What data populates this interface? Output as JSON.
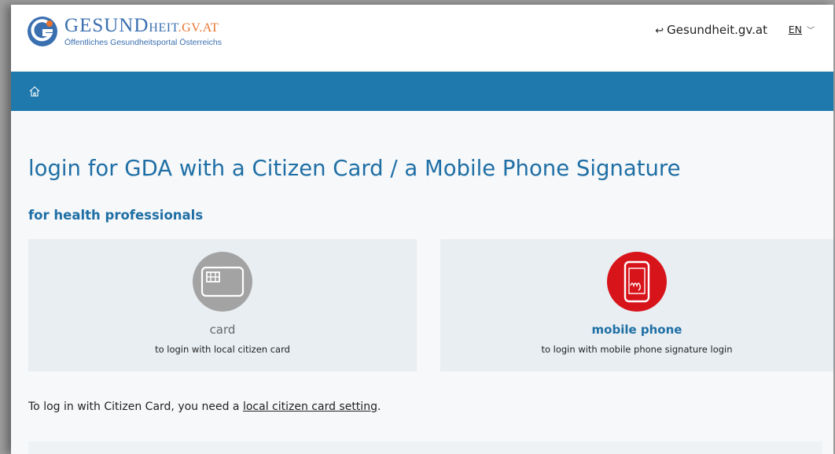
{
  "header": {
    "brand_big": "G",
    "brand_word": "ESUND",
    "brand_rest": "HEIT",
    "brand_domain": ".GV.AT",
    "tagline": "Öffentliches Gesundheitsportal Österreichs",
    "portal_link": "Gesundheit.gv.at",
    "language": "EN"
  },
  "main": {
    "title": "login for GDA with a Citizen Card / a Mobile Phone Signature",
    "subtitle": "for health professionals",
    "options": [
      {
        "label": "card",
        "description": "to login with local citizen card",
        "icon": "citizen-card-icon",
        "color": "#a3a3a3"
      },
      {
        "label": "mobile phone",
        "description": "to login with mobile phone signature login",
        "icon": "mobile-signature-icon",
        "color": "#d8141b"
      }
    ],
    "note_prefix": "To log in with Citizen Card, you need a ",
    "note_link": "local citizen card setting",
    "note_suffix": "."
  },
  "colors": {
    "accent": "#1f79ad",
    "heading": "#1f6fa5",
    "logo_orange": "#e8732e",
    "tile_background": "#e8eef2"
  }
}
